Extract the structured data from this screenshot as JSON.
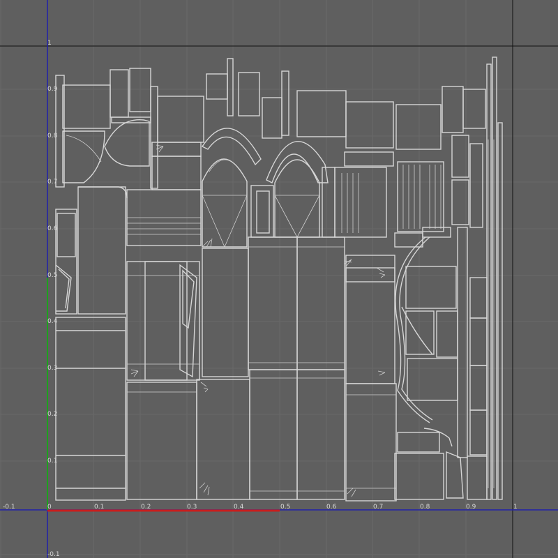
{
  "editor": {
    "view": "UV Texture Editor",
    "colors": {
      "background": "#5f5f5f",
      "grid": "#696969",
      "uv_bounds": "#111111",
      "axis_lines": "#2020aa",
      "u_axis_highlight": "#c81e1e",
      "v_axis_highlight": "#1ea01e",
      "uv_wireframe": "#d6d6d6"
    }
  },
  "axes": {
    "x_ticks": [
      "-0.1",
      "0",
      "0.1",
      "0.2",
      "0.3",
      "0.4",
      "0.5",
      "0.6",
      "0.7",
      "0.8",
      "0.9",
      "1"
    ],
    "y_ticks": [
      "1",
      "0.9",
      "0.8",
      "0.7",
      "0.6",
      "0.5",
      "0.4",
      "0.3",
      "0.2",
      "0.1",
      "-0.1"
    ]
  }
}
